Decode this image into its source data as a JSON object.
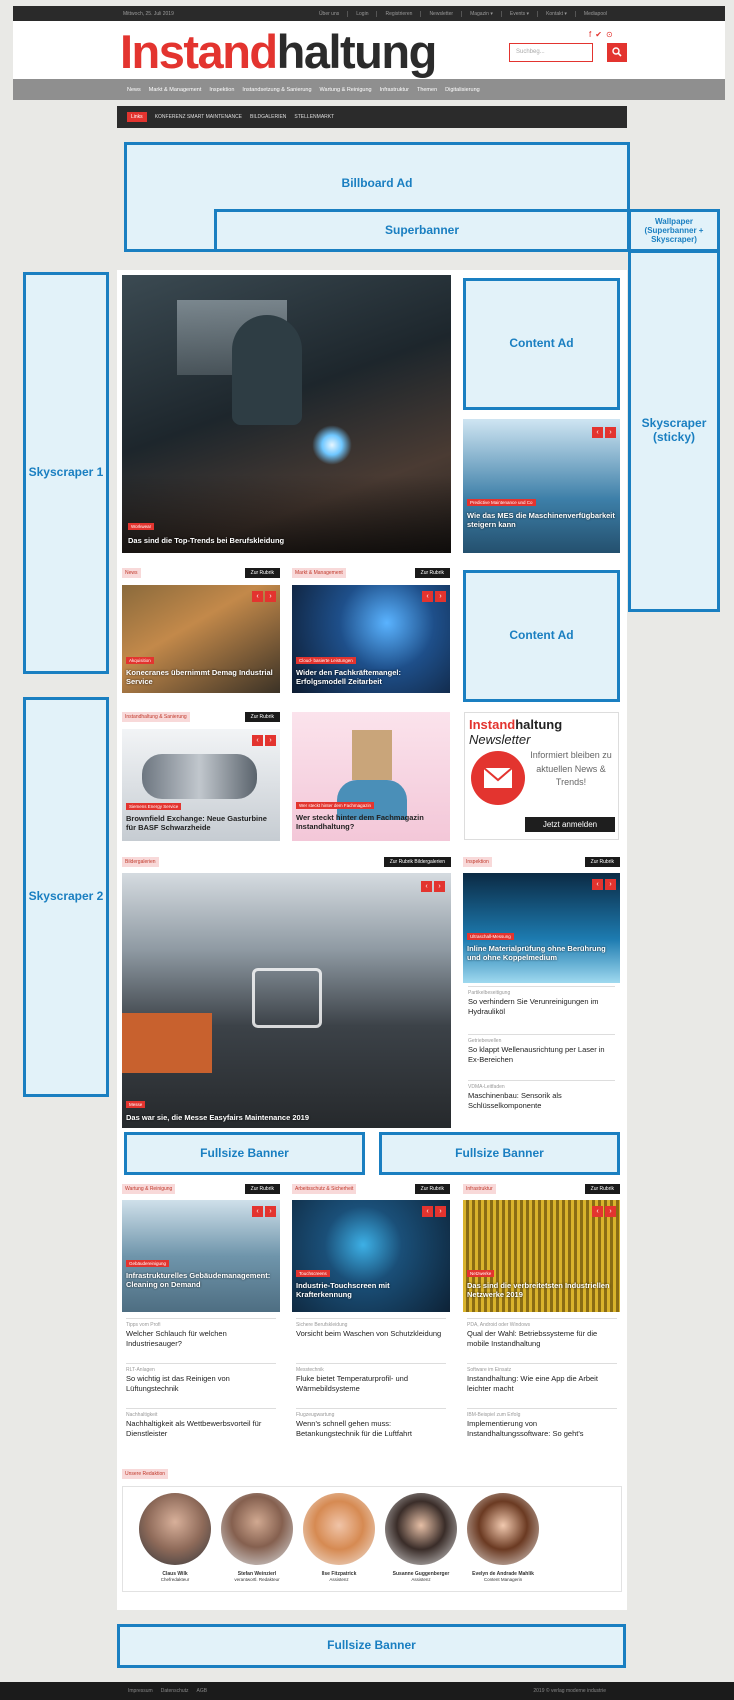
{
  "topbar": {
    "date": "Mittwoch, 25. Juli 2019",
    "links": [
      "Über uns",
      "Login",
      "Registrieren",
      "Newsletter",
      "Magazin ▾",
      "Events ▾",
      "Kontakt ▾",
      "Mediapool"
    ]
  },
  "header": {
    "logo_part1": "Instand",
    "logo_part2": "haltung",
    "search_placeholder": "Suchbeg...",
    "social": [
      "f",
      "✔",
      "⊙"
    ]
  },
  "mainnav": [
    "News",
    "Markt & Management",
    "Inspektion",
    "Instandsetzung & Sanierung",
    "Wartung & Reinigung",
    "Infrastruktur",
    "Themen",
    "Digitalisierung"
  ],
  "subnav": {
    "hot": "Links",
    "items": [
      "KONFERENZ SMART MAINTENANCE",
      "BILDGALERIEN",
      "STELLENMARKT"
    ]
  },
  "ads": {
    "billboard": "Billboard Ad",
    "superbanner": "Superbanner",
    "wallpaper": "Wallpaper (Superbanner + Skyscraper)",
    "skyscraper_sticky": "Skyscraper (sticky)",
    "skyscraper1": "Skyscraper 1",
    "skyscraper2": "Skyscraper 2",
    "content_ad1": "Content Ad",
    "content_ad2": "Content Ad",
    "fullsize1": "Fullsize Banner",
    "fullsize2": "Fullsize Banner",
    "fullsize3": "Fullsize Banner"
  },
  "hero": {
    "tag": "Workwear",
    "caption": "Das sind die Top-Trends bei Berufskleidung"
  },
  "side_teaser": {
    "tag": "Predictive Maintenance und Co",
    "caption": "Wie das MES die Maschinenverfügbarkeit steigern kann"
  },
  "row2": {
    "news": {
      "label": "News",
      "btn": "Zur Rubrik",
      "tag": "Akquisition",
      "caption": "Konecranes übernimmt Demag Industrial Service"
    },
    "markt": {
      "label": "Markt & Management",
      "btn": "Zur Rubrik",
      "tag": "Cloud- basierte Leistungen",
      "caption": "Wider den Fachkräftemangel: Erfolgsmodell Zeitarbeit"
    }
  },
  "row3": {
    "instand": {
      "label": "Instandhaltung & Sanierung",
      "btn": "Zur Rubrik",
      "tag": "Siemens Energy Service",
      "caption": "Brownfield Exchange: Neue Gasturbine für BASF Schwarzheide"
    },
    "quiz": {
      "tag": "Wer steckt hinter dem Fachmagazin",
      "caption": "Wer steckt hinter dem Fachmagazin Instandhaltung?"
    }
  },
  "newsletter": {
    "brand_red": "Instand",
    "brand_dark": "haltung",
    "word": "Newsletter",
    "text": "Informiert bleiben zu aktuellen News & Trends!",
    "button": "Jetzt anmelden"
  },
  "gallery": {
    "label": "Bildergalerien",
    "btn": "Zur Rubrik Bildergalerien",
    "tag": "Messe",
    "caption": "Das war sie, die Messe Easyfairs Maintenance 2019"
  },
  "inspektion": {
    "label": "Inspektion",
    "btn": "Zur Rubrik",
    "tag": "Ultraschall-Messung",
    "caption": "Inline Materialprüfung ohne Berührung und ohne Koppelmedium",
    "items": [
      {
        "kicker": "Partikelbeseitigung",
        "title": "So verhindern Sie Verunreinigungen im Hydrauliköl"
      },
      {
        "kicker": "Getriebewellen",
        "title": "So klappt Wellenausrichtung per Laser in Ex-Bereichen"
      },
      {
        "kicker": "VDMA-Leitfaden",
        "title": "Maschinenbau: Sensorik als Schlüsselkomponente"
      }
    ]
  },
  "bottom_cols": [
    {
      "label": "Wartung & Reinigung",
      "btn": "Zur Rubrik",
      "tag": "Gebäudereinigung",
      "caption": "Infrastrukturelles Gebäudemanagement: Cleaning on Demand",
      "items": [
        {
          "kicker": "Tipps vom Profi",
          "title": "Welcher Schlauch für welchen Industriesauger?"
        },
        {
          "kicker": "RLT-Anlagen",
          "title": "So wichtig ist das Reinigen von Lüftungstechnik"
        },
        {
          "kicker": "Nachhaltigkeit",
          "title": "Nachhaltigkeit als Wettbewerbsvorteil für Dienstleister"
        }
      ]
    },
    {
      "label": "Arbeitsschutz & Sicherheit",
      "btn": "Zur Rubrik",
      "tag": "Touchscreens",
      "caption": "Industrie-Touchscreen mit Krafterkennung",
      "items": [
        {
          "kicker": "Sichere Berufskleidung",
          "title": "Vorsicht beim Waschen von Schutzkleidung"
        },
        {
          "kicker": "Messtechnik",
          "title": "Fluke bietet Temperaturprofil- und Wärmebildsysteme"
        },
        {
          "kicker": "Flugzeugwartung",
          "title": "Wenn's schnell gehen muss: Betankungstechnik für die Luftfahrt"
        }
      ]
    },
    {
      "label": "Infrastruktur",
      "btn": "Zur Rubrik",
      "tag": "Netzwerke",
      "caption": "Das sind die verbreitetsten Industriellen Netzwerke 2019",
      "items": [
        {
          "kicker": "PDA, Android oder Windows",
          "title": "Qual der Wahl: Betriebssysteme für die mobile Instandhaltung"
        },
        {
          "kicker": "Software im Einsatz",
          "title": "Instandhaltung: Wie eine App die Arbeit leichter macht"
        },
        {
          "kicker": "IBM-Beispiel zum Erfolg",
          "title": "Implementierung von Instandhaltungssoftware: So geht's"
        }
      ]
    }
  ],
  "redaktion": {
    "label": "Unsere Redaktion",
    "people": [
      {
        "name": "Claus Wilk",
        "role": "Chefredakteur"
      },
      {
        "name": "Stefan Weinzierl",
        "role": "verantwortl. Redakteur"
      },
      {
        "name": "Ilse Fitzpatrick",
        "role": "Assistenz"
      },
      {
        "name": "Susanne Guggenberger",
        "role": "Assistenz"
      },
      {
        "name": "Evelyn de Andrade Mahlik",
        "role": "Content Managerin"
      }
    ]
  },
  "footer": {
    "links": [
      "Impressum",
      "Datenschutz",
      "AGB"
    ],
    "copyright": "2019 © verlag moderne industrie"
  },
  "colors": {
    "brand_red": "#e3342f",
    "ad_blue": "#1a7fc1",
    "ad_fill": "#e2f2f9"
  }
}
